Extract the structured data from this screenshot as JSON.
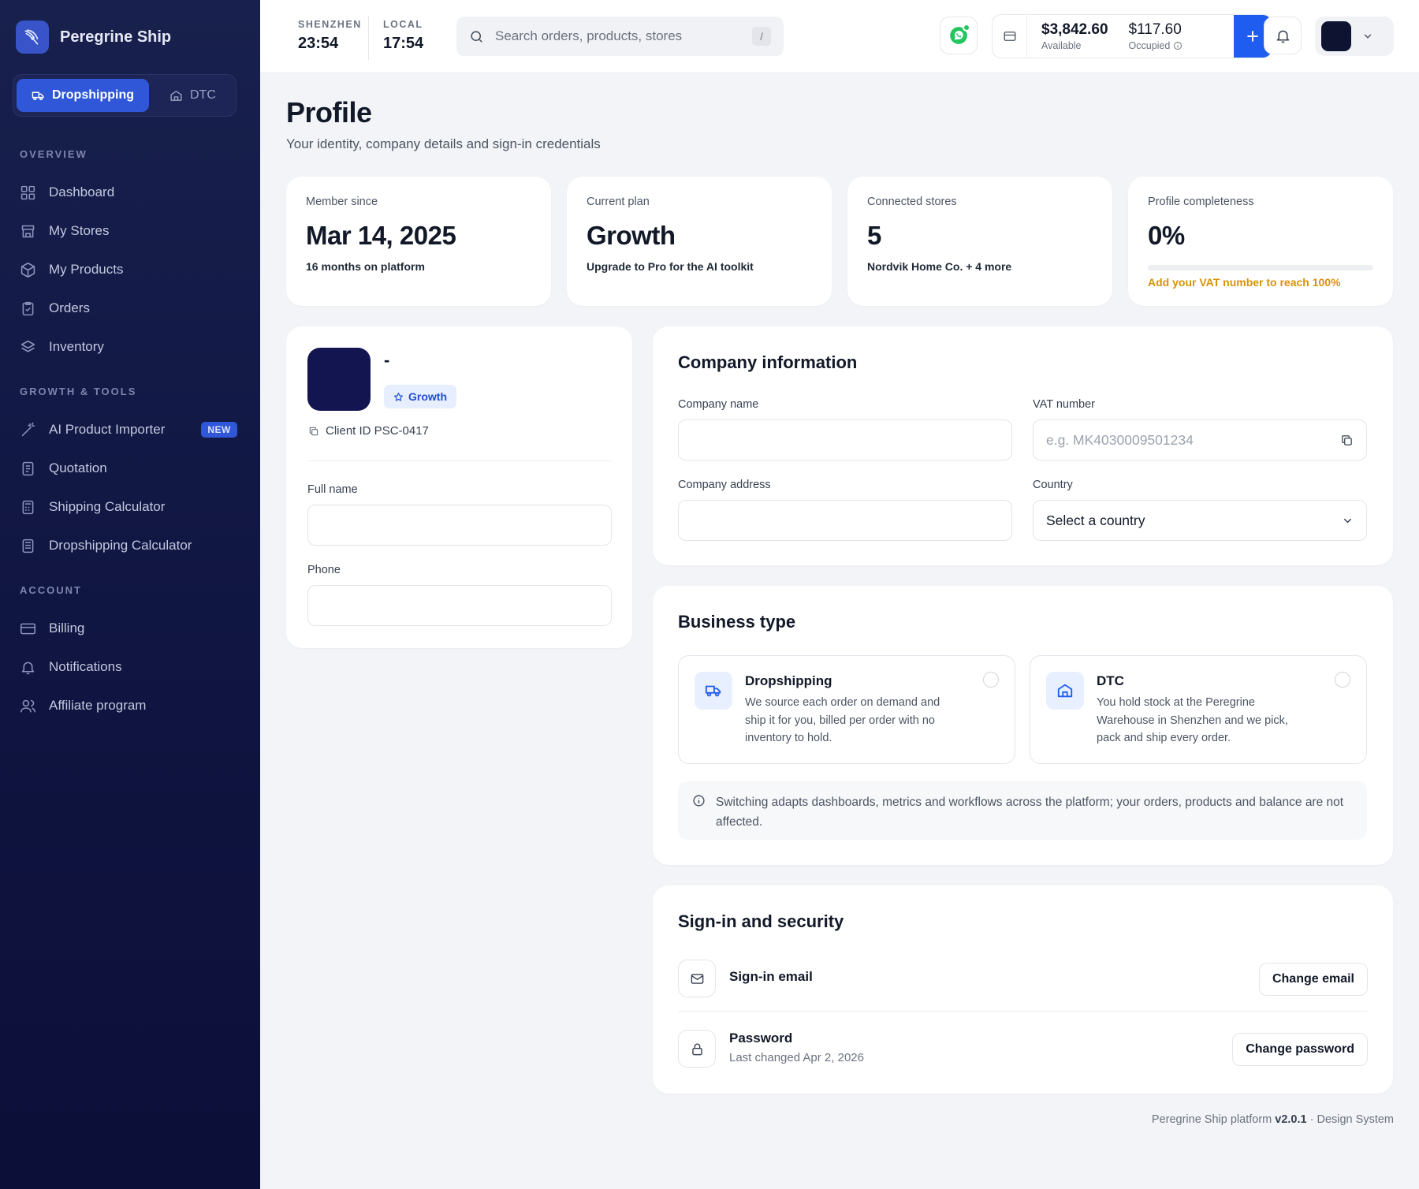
{
  "brand": {
    "name": "Peregrine Ship"
  },
  "mode_switch": {
    "active": "Dropshipping",
    "inactive": "DTC"
  },
  "sidebar": {
    "sections": [
      "OVERVIEW",
      "GROWTH & TOOLS",
      "ACCOUNT"
    ],
    "overview": [
      {
        "label": "Dashboard",
        "icon": "grid-icon"
      },
      {
        "label": "My Stores",
        "icon": "store-icon"
      },
      {
        "label": "My Products",
        "icon": "box-icon"
      },
      {
        "label": "Orders",
        "icon": "clipboard-icon"
      },
      {
        "label": "Inventory",
        "icon": "layers-icon"
      }
    ],
    "growth": [
      {
        "label": "AI Product Importer",
        "icon": "magic-wand-icon",
        "badge": "NEW"
      },
      {
        "label": "Quotation",
        "icon": "document-icon"
      },
      {
        "label": "Shipping Calculator",
        "icon": "calculator-icon"
      },
      {
        "label": "Dropshipping Calculator",
        "icon": "calculator-icon"
      }
    ],
    "account": [
      {
        "label": "Billing",
        "icon": "credit-card-icon"
      },
      {
        "label": "Notifications",
        "icon": "bell-icon"
      },
      {
        "label": "Affiliate program",
        "icon": "users-icon"
      }
    ]
  },
  "header": {
    "clocks": [
      {
        "city": "SHENZHEN",
        "time": "23:54"
      },
      {
        "city": "LOCAL",
        "time": "17:54"
      }
    ],
    "search": {
      "placeholder": "Search orders, products, stores",
      "shortcut": "/"
    },
    "wallet": {
      "available_amount": "$3,842.60",
      "available_label": "Available",
      "occupied_amount": "$117.60",
      "occupied_label": "Occupied"
    }
  },
  "page": {
    "title": "Profile",
    "subtitle": "Your identity, company details and sign-in credentials"
  },
  "stats": {
    "member": {
      "label": "Member since",
      "value": "Mar 14, 2025",
      "note": "16 months on platform"
    },
    "plan": {
      "label": "Current plan",
      "value": "Growth",
      "note": "Upgrade to Pro for the AI toolkit"
    },
    "stores": {
      "label": "Connected stores",
      "value": "5",
      "note": "Nordvik Home Co. + 4 more"
    },
    "completeness": {
      "label": "Profile completeness",
      "value": "0%",
      "progress_fraction": 0,
      "note": "Add your VAT number to reach 100%"
    }
  },
  "profile": {
    "name": "-",
    "plan_badge": "Growth",
    "client_id": "Client ID PSC-0417",
    "full_name_label": "Full name",
    "full_name_value": "",
    "phone_label": "Phone",
    "phone_value": ""
  },
  "company": {
    "title": "Company information",
    "name_label": "Company name",
    "name_value": "",
    "vat_label": "VAT number",
    "vat_placeholder": "e.g. MK4030009501234",
    "address_label": "Company address",
    "address_value": "",
    "country_label": "Country",
    "country_value": "Select a country"
  },
  "business": {
    "title": "Business type",
    "options": [
      {
        "title": "Dropshipping",
        "desc": "We source each order on demand and ship it for you, billed per order with no inventory to hold.",
        "icon": "truck-icon"
      },
      {
        "title": "DTC",
        "desc": "You hold stock at the Peregrine Warehouse in Shenzhen and we pick, pack and ship every order.",
        "icon": "warehouse-icon"
      }
    ],
    "note": "Switching adapts dashboards, metrics and workflows across the platform; your orders, products and balance are not affected."
  },
  "security": {
    "title": "Sign-in and security",
    "email_title": "Sign-in email",
    "email_button": "Change email",
    "password_title": "Password",
    "password_sub": "Last changed Apr 2, 2026",
    "password_button": "Change password"
  },
  "footer": {
    "prefix": "Peregrine Ship platform",
    "version": "v2.0.1",
    "suffix": "· Design System"
  },
  "colors": {
    "accent": "#1f5cf0",
    "sidebar": "#0f1440",
    "warning": "#d99206",
    "whatsapp": "#22c55e"
  }
}
